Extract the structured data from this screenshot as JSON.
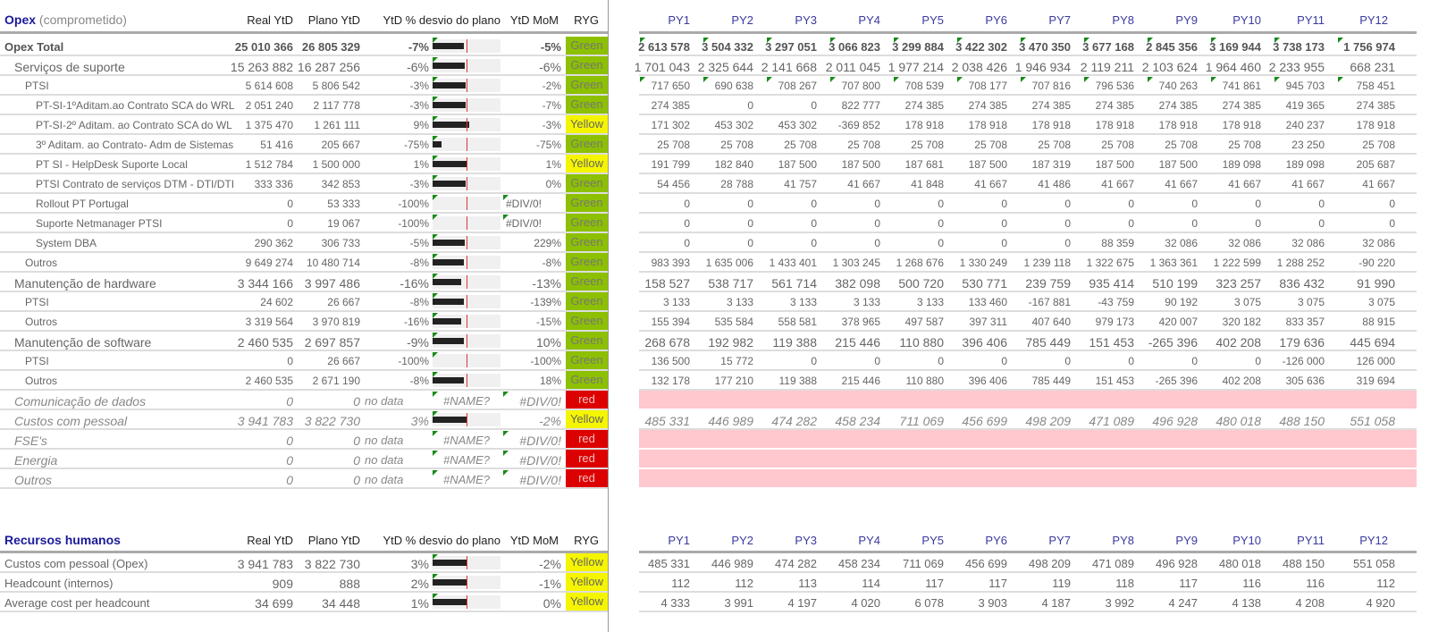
{
  "opex": {
    "title": "Opex",
    "subtitle": "(comprometido)",
    "columns": [
      "Real YtD",
      "Plano YtD",
      "YtD % desvio do plano",
      "YtD MoM",
      "RYG"
    ],
    "py_columns": [
      "PY1",
      "PY2",
      "PY3",
      "PY4",
      "PY5",
      "PY6",
      "PY7",
      "PY8",
      "PY9",
      "PY10",
      "PY11",
      "PY12"
    ],
    "rows": [
      {
        "label": "Opex Total",
        "level": 0,
        "real": "25 010 366",
        "plan": "26 805 329",
        "pct": "-7%",
        "mom": "-5%",
        "ryg": "Green",
        "py": [
          "2 613 578",
          "3 504 332",
          "3 297 051",
          "3 066 823",
          "3 299 884",
          "3 422 302",
          "3 470 350",
          "3 677 168",
          "2 845 356",
          "3 169 944",
          "3 738 173",
          "1 756 974"
        ]
      },
      {
        "label": "Serviços de suporte",
        "level": 1,
        "real": "15 263 882",
        "plan": "16 287 256",
        "pct": "-6%",
        "mom": "-6%",
        "ryg": "Green",
        "py": [
          "1 701 043",
          "2 325 644",
          "2 141 668",
          "2 011 045",
          "1 977 214",
          "2 038 426",
          "1 946 934",
          "2 119 211",
          "2 103 624",
          "1 964 460",
          "2 233 955",
          "668 231"
        ]
      },
      {
        "label": "PTSI",
        "level": 2,
        "real": "5 614 608",
        "plan": "5 806 542",
        "pct": "-3%",
        "mom": "-2%",
        "ryg": "Green",
        "py": [
          "717 650",
          "690 638",
          "708 267",
          "707 800",
          "708 539",
          "708 177",
          "707 816",
          "796 536",
          "740 263",
          "741 861",
          "945 703",
          "758 451"
        ]
      },
      {
        "label": "PT-SI-1ºAditam.ao Contrato SCA do WRL",
        "level": 3,
        "real": "2 051 240",
        "plan": "2 117 778",
        "pct": "-3%",
        "mom": "-7%",
        "ryg": "Green",
        "py": [
          "274 385",
          "0",
          "0",
          "822 777",
          "274 385",
          "274 385",
          "274 385",
          "274 385",
          "274 385",
          "274 385",
          "419 365",
          "274 385"
        ]
      },
      {
        "label": "PT-SI-2º Aditam. ao Contrato SCA do WL",
        "level": 3,
        "real": "1 375 470",
        "plan": "1 261 111",
        "pct": "9%",
        "mom": "-3%",
        "ryg": "Yellow",
        "py": [
          "171 302",
          "453 302",
          "453 302",
          "-369 852",
          "178 918",
          "178 918",
          "178 918",
          "178 918",
          "178 918",
          "178 918",
          "240 237",
          "178 918"
        ]
      },
      {
        "label": "3º Aditam. ao Contrato- Adm de Sistemas",
        "level": 3,
        "real": "51 416",
        "plan": "205 667",
        "pct": "-75%",
        "mom": "-75%",
        "ryg": "Green",
        "py": [
          "25 708",
          "25 708",
          "25 708",
          "25 708",
          "25 708",
          "25 708",
          "25 708",
          "25 708",
          "25 708",
          "25 708",
          "23 250",
          "25 708"
        ]
      },
      {
        "label": "PT SI - HelpDesk Suporte Local",
        "level": 3,
        "real": "1 512 784",
        "plan": "1 500 000",
        "pct": "1%",
        "mom": "1%",
        "ryg": "Yellow",
        "py": [
          "191 799",
          "182 840",
          "187 500",
          "187 500",
          "187 681",
          "187 500",
          "187 319",
          "187 500",
          "187 500",
          "189 098",
          "189 098",
          "205 687"
        ]
      },
      {
        "label": "PTSI Contrato de serviços DTM - DTI/DTI",
        "level": 3,
        "real": "333 336",
        "plan": "342 853",
        "pct": "-3%",
        "mom": "0%",
        "ryg": "Green",
        "py": [
          "54 456",
          "28 788",
          "41 757",
          "41 667",
          "41 848",
          "41 667",
          "41 486",
          "41 667",
          "41 667",
          "41 667",
          "41 667",
          "41 667"
        ]
      },
      {
        "label": "Rollout PT Portugal",
        "level": 3,
        "real": "0",
        "plan": "53 333",
        "pct": "-100%",
        "mom": "#DIV/0!",
        "ryg": "Green",
        "py": [
          "0",
          "0",
          "0",
          "0",
          "0",
          "0",
          "0",
          "0",
          "0",
          "0",
          "0",
          "0"
        ]
      },
      {
        "label": "Suporte Netmanager PTSI",
        "level": 3,
        "real": "0",
        "plan": "19 067",
        "pct": "-100%",
        "mom": "#DIV/0!",
        "ryg": "Green",
        "py": [
          "0",
          "0",
          "0",
          "0",
          "0",
          "0",
          "0",
          "0",
          "0",
          "0",
          "0",
          "0"
        ]
      },
      {
        "label": "System DBA",
        "level": 3,
        "real": "290 362",
        "plan": "306 733",
        "pct": "-5%",
        "mom": "229%",
        "ryg": "Green",
        "py": [
          "0",
          "0",
          "0",
          "0",
          "0",
          "0",
          "0",
          "88 359",
          "32 086",
          "32 086",
          "32 086",
          "32 086"
        ]
      },
      {
        "label": "Outros",
        "level": 2,
        "real": "9 649 274",
        "plan": "10 480 714",
        "pct": "-8%",
        "mom": "-8%",
        "ryg": "Green",
        "py": [
          "983 393",
          "1 635 006",
          "1 433 401",
          "1 303 245",
          "1 268 676",
          "1 330 249",
          "1 239 118",
          "1 322 675",
          "1 363 361",
          "1 222 599",
          "1 288 252",
          "-90 220"
        ]
      },
      {
        "label": "Manutenção de hardware",
        "level": 1,
        "real": "3 344 166",
        "plan": "3 997 486",
        "pct": "-16%",
        "mom": "-13%",
        "ryg": "Green",
        "py": [
          "158 527",
          "538 717",
          "561 714",
          "382 098",
          "500 720",
          "530 771",
          "239 759",
          "935 414",
          "510 199",
          "323 257",
          "836 432",
          "91 990"
        ]
      },
      {
        "label": "PTSI",
        "level": 2,
        "real": "24 602",
        "plan": "26 667",
        "pct": "-8%",
        "mom": "-139%",
        "ryg": "Green",
        "py": [
          "3 133",
          "3 133",
          "3 133",
          "3 133",
          "3 133",
          "133 460",
          "-167 881",
          "-43 759",
          "90 192",
          "3 075",
          "3 075",
          "3 075"
        ]
      },
      {
        "label": "Outros",
        "level": 2,
        "real": "3 319 564",
        "plan": "3 970 819",
        "pct": "-16%",
        "mom": "-15%",
        "ryg": "Green",
        "py": [
          "155 394",
          "535 584",
          "558 581",
          "378 965",
          "497 587",
          "397 311",
          "407 640",
          "979 173",
          "420 007",
          "320 182",
          "833 357",
          "88 915"
        ]
      },
      {
        "label": "Manutenção de software",
        "level": 1,
        "real": "2 460 535",
        "plan": "2 697 857",
        "pct": "-9%",
        "mom": "10%",
        "ryg": "Green",
        "py": [
          "268 678",
          "192 982",
          "119 388",
          "215 446",
          "110 880",
          "396 406",
          "785 449",
          "151 453",
          "-265 396",
          "402 208",
          "179 636",
          "445 694"
        ]
      },
      {
        "label": "PTSI",
        "level": 2,
        "real": "0",
        "plan": "26 667",
        "pct": "-100%",
        "mom": "-100%",
        "ryg": "Green",
        "py": [
          "136 500",
          "15 772",
          "0",
          "0",
          "0",
          "0",
          "0",
          "0",
          "0",
          "0",
          "-126 000",
          "126 000"
        ]
      },
      {
        "label": "Outros",
        "level": 2,
        "real": "2 460 535",
        "plan": "2 671 190",
        "pct": "-8%",
        "mom": "18%",
        "ryg": "Green",
        "py": [
          "132 178",
          "177 210",
          "119 388",
          "215 446",
          "110 880",
          "396 406",
          "785 449",
          "151 453",
          "-265 396",
          "402 208",
          "305 636",
          "319 694"
        ]
      },
      {
        "label": "Comunicação de dados",
        "level": "it",
        "real": "0",
        "plan": "0",
        "nodata": "no data",
        "bartext": "#NAME?",
        "mom": "#DIV/0!",
        "ryg": "red",
        "py": []
      },
      {
        "label": "Custos com pessoal",
        "level": "it",
        "real": "3 941 783",
        "plan": "3 822 730",
        "pct": "3%",
        "mom": "-2%",
        "ryg": "Yellow",
        "py": [
          "485 331",
          "446 989",
          "474 282",
          "458 234",
          "711 069",
          "456 699",
          "498 209",
          "471 089",
          "496 928",
          "480 018",
          "488 150",
          "551 058"
        ]
      },
      {
        "label": "FSE's",
        "level": "it",
        "real": "0",
        "plan": "0",
        "nodata": "no data",
        "bartext": "#NAME?",
        "mom": "#DIV/0!",
        "ryg": "red",
        "py": []
      },
      {
        "label": "Energia",
        "level": "it",
        "real": "0",
        "plan": "0",
        "nodata": "no data",
        "bartext": "#NAME?",
        "mom": "#DIV/0!",
        "ryg": "red",
        "py": []
      },
      {
        "label": "Outros",
        "level": "it",
        "real": "0",
        "plan": "0",
        "nodata": "no data",
        "bartext": "#NAME?",
        "mom": "#DIV/0!",
        "ryg": "red",
        "py": []
      }
    ]
  },
  "hr": {
    "title": "Recursos humanos",
    "columns": [
      "Real YtD",
      "Plano YtD",
      "YtD % desvio do plano",
      "YtD MoM",
      "RYG"
    ],
    "py_columns": [
      "PY1",
      "PY2",
      "PY3",
      "PY4",
      "PY5",
      "PY6",
      "PY7",
      "PY8",
      "PY9",
      "PY10",
      "PY11",
      "PY12"
    ],
    "rows": [
      {
        "label": "Custos com pessoal (Opex)",
        "level": "hr",
        "real": "3 941 783",
        "plan": "3 822 730",
        "pct": "3%",
        "mom": "-2%",
        "ryg": "Yellow",
        "py": [
          "485 331",
          "446 989",
          "474 282",
          "458 234",
          "711 069",
          "456 699",
          "498 209",
          "471 089",
          "496 928",
          "480 018",
          "488 150",
          "551 058"
        ]
      },
      {
        "label": "Headcount (internos)",
        "level": "hr",
        "real": "909",
        "plan": "888",
        "pct": "2%",
        "mom": "-1%",
        "ryg": "Yellow",
        "py": [
          "112",
          "112",
          "113",
          "114",
          "117",
          "117",
          "119",
          "118",
          "117",
          "116",
          "116",
          "112"
        ]
      },
      {
        "label": "Average cost per headcount",
        "level": "hr",
        "real": "34 699",
        "plan": "34 448",
        "pct": "1%",
        "mom": "0%",
        "ryg": "Yellow",
        "py": [
          "4 333",
          "3 991",
          "4 197",
          "4 020",
          "6 078",
          "3 903",
          "4 187",
          "3 992",
          "4 247",
          "4 138",
          "4 208",
          "4 920"
        ]
      }
    ]
  },
  "colors": {
    "green": "#8cc000",
    "yellow": "#f5f500",
    "red": "#dd0000",
    "pink": "#ffc7ce",
    "title": "#1a1a9a"
  }
}
